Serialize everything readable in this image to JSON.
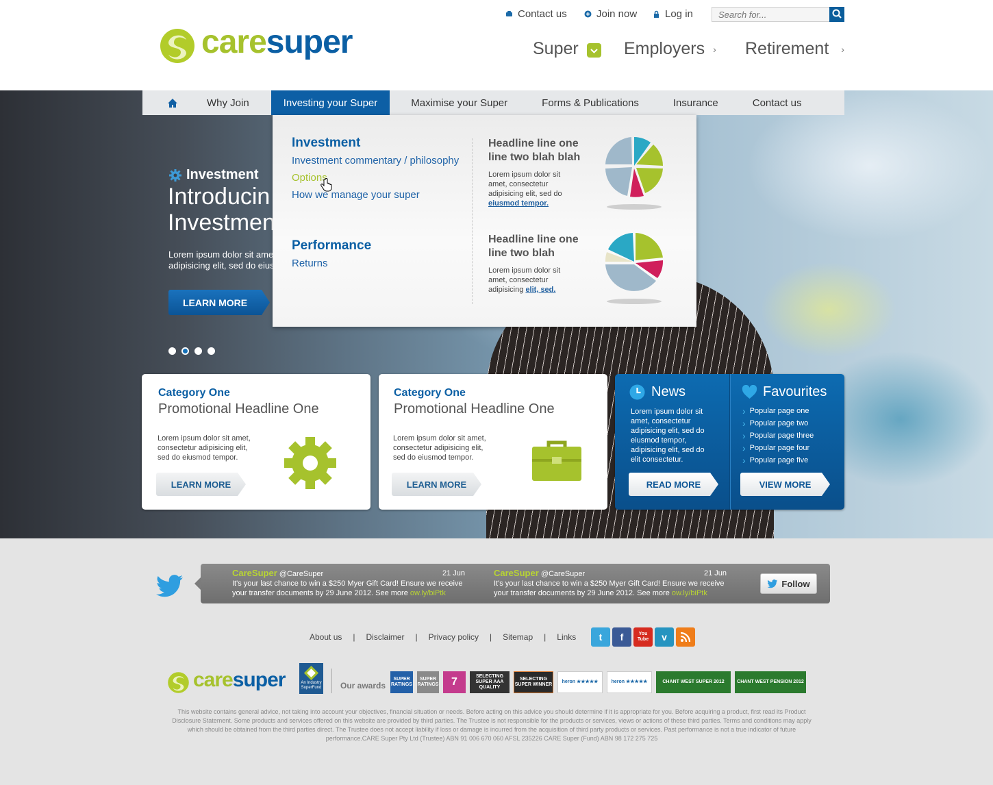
{
  "brand": {
    "care": "care",
    "super": "super",
    "accent": "#a6c22d",
    "blue": "#0b5fa4"
  },
  "toplinks": [
    {
      "label": "Contact us",
      "icon": "phone-icon"
    },
    {
      "label": "Join now",
      "icon": "plus-icon"
    },
    {
      "label": "Log in",
      "icon": "lock-icon"
    }
  ],
  "search": {
    "placeholder": "Search for..."
  },
  "mainnav": [
    {
      "label": "Super"
    },
    {
      "label": "Employers"
    },
    {
      "label": "Retirement"
    }
  ],
  "subnav": [
    {
      "label": "Why Join"
    },
    {
      "label": "Investing your Super"
    },
    {
      "label": "Maximise your Super"
    },
    {
      "label": "Forms & Publications"
    },
    {
      "label": "Insurance"
    },
    {
      "label": "Contact us"
    }
  ],
  "hero": {
    "kicker": "Investment",
    "title_line1": "Introducin",
    "title_line2": "Investmen",
    "body_line1": "Lorem ipsum dolor sit ame",
    "body_line2": "adipisicing elit, sed do eius",
    "button": "LEARN MORE"
  },
  "dropdown": {
    "investment": {
      "heading": "Investment",
      "links": [
        "Investment commentary / philosophy",
        "Options",
        "How we manage your super"
      ]
    },
    "performance": {
      "heading": "Performance",
      "links": [
        "Returns"
      ]
    },
    "promos": [
      {
        "headline_l1": "Headline line one",
        "headline_l2": "line two blah blah",
        "body_l1": "Lorem ipsum dolor sit",
        "body_l2": "amet, consectetur",
        "body_l3": "adipisicing elit, sed do",
        "link": "eiusmod tempor."
      },
      {
        "headline_l1": "Headline line one",
        "headline_l2": "line two blah",
        "body_l1": "Lorem ipsum dolor sit",
        "body_l2": "amet, consectetur",
        "body_l3": "adipisicing",
        "link": "elit, sed."
      }
    ]
  },
  "cards": [
    {
      "category": "Category One",
      "headline": "Promotional Headline One",
      "body_l1": "Lorem ipsum dolor sit amet,",
      "body_l2": "consectetur adipisicing elit,",
      "body_l3": "sed do eiusmod tempor.",
      "button": "LEARN MORE",
      "icon": "gear-icon"
    },
    {
      "category": "Category One",
      "headline": "Promotional Headline One",
      "body_l1": "Lorem ipsum dolor sit amet,",
      "body_l2": "consectetur adipisicing elit,",
      "body_l3": "sed do eiusmod tempor.",
      "button": "LEARN MORE",
      "icon": "briefcase-icon"
    }
  ],
  "news": {
    "title": "News",
    "body_l1": "Lorem ipsum dolor sit",
    "body_l2": "amet, consectetur",
    "body_l3": "adipisicing elit, sed do",
    "body_l4": "eiusmod tempor,",
    "body_l5": "adipisicing elit, sed do",
    "body_l6": "elit consectetur.",
    "button": "READ MORE"
  },
  "favourites": {
    "title": "Favourites",
    "items": [
      "Popular page one",
      "Popular page two",
      "Popular page three",
      "Popular page four",
      "Popular page five"
    ],
    "button": "VIEW MORE"
  },
  "tweets": [
    {
      "name": "CareSuper",
      "handle": "@CareSuper",
      "date": "21 Jun",
      "line1": "It's your last chance to win a $250 Myer Gift Card! Ensure we receive",
      "line2": "your transfer documents by 29 June 2012. See more",
      "link": "ow.ly/biPtk"
    },
    {
      "name": "CareSuper",
      "handle": "@CareSuper",
      "date": "21 Jun",
      "line1": "It's your last chance to win a $250 Myer Gift Card! Ensure we receive",
      "line2": "your transfer documents by 29 June 2012. See more",
      "link": "ow.ly/biPtk"
    }
  ],
  "follow": "Follow",
  "footerlinks": [
    "About us",
    "Disclaimer",
    "Privacy policy",
    "Sitemap",
    "Links"
  ],
  "social": [
    {
      "label": "t",
      "icon": "twitter-icon",
      "color": "#3aa6dc"
    },
    {
      "label": "f",
      "icon": "facebook-icon",
      "color": "#3b5a96"
    },
    {
      "label": "You Tube",
      "icon": "youtube-icon",
      "color": "#d62b1f"
    },
    {
      "label": "v",
      "icon": "vimeo-icon",
      "color": "#2694c0"
    },
    {
      "label": "",
      "icon": "rss-icon",
      "color": "#ef7d1a"
    }
  ],
  "industry": "An Industry SuperFund",
  "ourawards": "Our awards",
  "awards": [
    {
      "label": "SUPER RATINGS",
      "color": "#2360a8"
    },
    {
      "label": "SUPER RATINGS",
      "color": "#8a8a8a"
    },
    {
      "label": "7",
      "color": "#c43b8d"
    },
    {
      "label": "SELECTING SUPER AAA QUALITY",
      "color": "#333"
    },
    {
      "label": "SELECTING SUPER WINNER",
      "color": "#2a2a2a"
    },
    {
      "label": "heron ★★★★★",
      "color": "#1c68a8"
    },
    {
      "label": "heron ★★★★★",
      "color": "#1c68a8"
    },
    {
      "label": "CHANT WEST SUPER 2012",
      "color": "#2b7a2e"
    },
    {
      "label": "CHANT WEST PENSION 2012",
      "color": "#2b7a2e"
    }
  ],
  "disclaimer": "This website contains general advice, not taking into account your objectives, financial situation or needs. Before acting on this advice you should determine if it is appropriate for you. Before acquiring a product, first read its Product Disclosure Statement. Some products and services offered on this website are provided by third parties. The Trustee is not responsible for the products or services, views or actions of these third parties. Terms and conditions may apply which should be obtained from the third parties direct. The Trustee does not accept liability if loss or damage is incurred from the acquisition of third party products or services. Past performance is not a true indicator of future performance.CARE Super Pty Ltd (Trustee) ABN 91 006 670 060 AFSL 235226 CARE Super (Fund) ABN 98 172 275 725"
}
